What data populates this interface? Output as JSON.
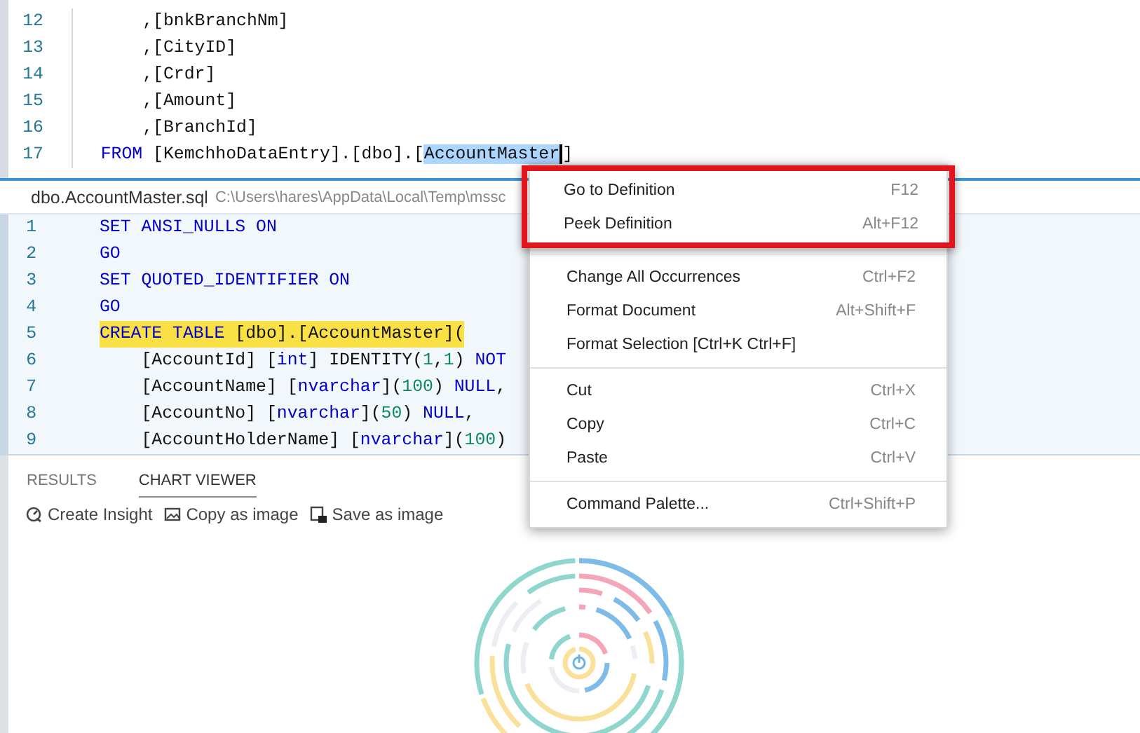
{
  "editor": {
    "lines": [
      {
        "number": "12",
        "tokens": [
          {
            "text": "      ,[bnkBranchNm]",
            "kind": "plain"
          }
        ]
      },
      {
        "number": "13",
        "tokens": [
          {
            "text": "      ,[CityID]",
            "kind": "plain"
          }
        ]
      },
      {
        "number": "14",
        "tokens": [
          {
            "text": "      ,[Crdr]",
            "kind": "plain"
          }
        ]
      },
      {
        "number": "15",
        "tokens": [
          {
            "text": "      ,[Amount]",
            "kind": "plain"
          }
        ]
      },
      {
        "number": "16",
        "tokens": [
          {
            "text": "      ,[BranchId]",
            "kind": "plain"
          }
        ]
      },
      {
        "number": "17",
        "tokens": [
          {
            "text": "  FROM",
            "kind": "keyword"
          },
          {
            "text": " [KemchhoDataEntry].[dbo].[",
            "kind": "plain"
          },
          {
            "text": "AccountMaster",
            "kind": "selection"
          },
          {
            "text": "]",
            "kind": "plain"
          }
        ]
      }
    ]
  },
  "peek": {
    "file_name": "dbo.AccountMaster.sql",
    "file_path": "C:\\Users\\hares\\AppData\\Local\\Temp\\mssc",
    "lines": [
      {
        "number": "1",
        "highlighted": false,
        "tokens": [
          {
            "text": "SET ANSI_NULLS ON",
            "kind": "keyword"
          }
        ]
      },
      {
        "number": "2",
        "highlighted": false,
        "tokens": [
          {
            "text": "GO",
            "kind": "keyword"
          }
        ]
      },
      {
        "number": "3",
        "highlighted": false,
        "tokens": [
          {
            "text": "SET QUOTED_IDENTIFIER ON",
            "kind": "keyword"
          }
        ]
      },
      {
        "number": "4",
        "highlighted": false,
        "tokens": [
          {
            "text": "GO",
            "kind": "keyword"
          }
        ]
      },
      {
        "number": "5",
        "highlighted": true,
        "tokens": [
          {
            "text": "CREATE TABLE",
            "kind": "keyword"
          },
          {
            "text": " [dbo].[AccountMaster](",
            "kind": "plain"
          }
        ]
      },
      {
        "number": "6",
        "highlighted": false,
        "tokens": [
          {
            "text": "    [AccountId] [",
            "kind": "plain"
          },
          {
            "text": "int",
            "kind": "keyword"
          },
          {
            "text": "] IDENTITY(",
            "kind": "plain"
          },
          {
            "text": "1",
            "kind": "number"
          },
          {
            "text": ",",
            "kind": "plain"
          },
          {
            "text": "1",
            "kind": "number"
          },
          {
            "text": ") ",
            "kind": "plain"
          },
          {
            "text": "NOT",
            "kind": "keyword"
          }
        ]
      },
      {
        "number": "7",
        "highlighted": false,
        "tokens": [
          {
            "text": "    [AccountName] [",
            "kind": "plain"
          },
          {
            "text": "nvarchar",
            "kind": "keyword"
          },
          {
            "text": "](",
            "kind": "plain"
          },
          {
            "text": "100",
            "kind": "number"
          },
          {
            "text": ") ",
            "kind": "plain"
          },
          {
            "text": "NULL",
            "kind": "keyword"
          },
          {
            "text": ",",
            "kind": "plain"
          }
        ]
      },
      {
        "number": "8",
        "highlighted": false,
        "tokens": [
          {
            "text": "    [AccountNo] [",
            "kind": "plain"
          },
          {
            "text": "nvarchar",
            "kind": "keyword"
          },
          {
            "text": "](",
            "kind": "plain"
          },
          {
            "text": "50",
            "kind": "number"
          },
          {
            "text": ") ",
            "kind": "plain"
          },
          {
            "text": "NULL",
            "kind": "keyword"
          },
          {
            "text": ",",
            "kind": "plain"
          }
        ]
      },
      {
        "number": "9",
        "highlighted": false,
        "tokens": [
          {
            "text": "    [AccountHolderName] [",
            "kind": "plain"
          },
          {
            "text": "nvarchar",
            "kind": "keyword"
          },
          {
            "text": "](",
            "kind": "plain"
          },
          {
            "text": "100",
            "kind": "number"
          },
          {
            "text": ")",
            "kind": "plain"
          }
        ]
      }
    ]
  },
  "context_menu": {
    "groups": [
      {
        "outlined": true,
        "items": [
          {
            "label": "Go to Definition",
            "shortcut": "F12"
          },
          {
            "label": "Peek Definition",
            "shortcut": "Alt+F12"
          }
        ]
      },
      {
        "outlined": false,
        "items": [
          {
            "label": "Change All Occurrences",
            "shortcut": "Ctrl+F2"
          },
          {
            "label": "Format Document",
            "shortcut": "Alt+Shift+F"
          },
          {
            "label": "Format Selection [Ctrl+K Ctrl+F]"
          }
        ]
      },
      {
        "outlined": false,
        "items": [
          {
            "label": "Cut",
            "shortcut": "Ctrl+X"
          },
          {
            "label": "Copy",
            "shortcut": "Ctrl+C"
          },
          {
            "label": "Paste",
            "shortcut": "Ctrl+V"
          }
        ]
      },
      {
        "outlined": false,
        "items": [
          {
            "label": "Command Palette...",
            "shortcut": "Ctrl+Shift+P"
          }
        ]
      }
    ]
  },
  "results_panel": {
    "tabs": [
      {
        "label": "RESULTS",
        "selected": false
      },
      {
        "label": "CHART VIEWER",
        "selected": true
      }
    ],
    "actions": [
      {
        "label": "Create Insight",
        "kind": "insight"
      },
      {
        "label": "Copy as image",
        "kind": "copy"
      },
      {
        "label": "Save as image",
        "kind": "save"
      }
    ]
  }
}
